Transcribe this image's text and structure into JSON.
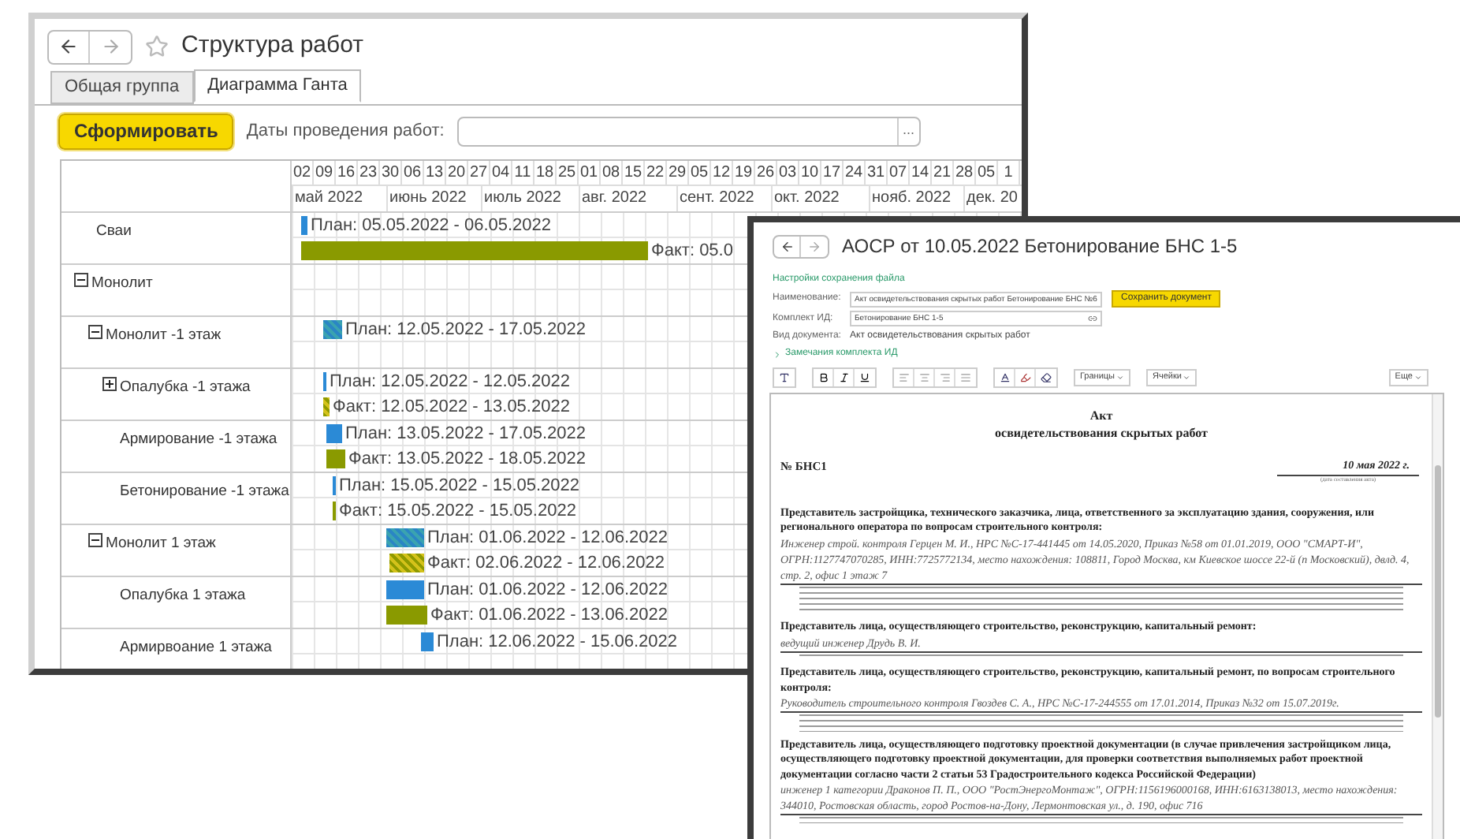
{
  "gantt_window": {
    "title": "Структура работ",
    "tabs": [
      {
        "label": "Общая группа",
        "selected": false
      },
      {
        "label": "Диаграмма Ганта",
        "selected": true
      }
    ],
    "generate_button": "Сформировать",
    "dates_label": "Даты проведения работ:",
    "dates_field_button": "...",
    "gantt": {
      "week_days": [
        "02",
        "09",
        "16",
        "23",
        "30",
        "06",
        "13",
        "20",
        "27",
        "04",
        "11",
        "18",
        "25",
        "01",
        "08",
        "15",
        "22",
        "29",
        "05",
        "12",
        "19",
        "26",
        "03",
        "10",
        "17",
        "24",
        "31",
        "07",
        "14",
        "21",
        "28",
        "05",
        "1"
      ],
      "months": [
        "май 2022",
        "июнь 2022",
        "июль 2022",
        "авг. 2022",
        "сент. 2022",
        "окт. 2022",
        "нояб. 2022",
        "дек. 20"
      ],
      "rows": [
        {
          "name": "Сваи",
          "bars": [
            {
              "kind": "plan",
              "hatched": false,
              "label": "План: 05.05.2022 - 06.05.2022"
            },
            {
              "kind": "fact",
              "hatched": false,
              "label": "Факт: 05.0"
            }
          ]
        },
        {
          "name": "Монолит",
          "expanded": true,
          "bars": [],
          "children": [
            {
              "name": "Монолит -1 этаж",
              "expanded": true,
              "bars": [
                {
                  "kind": "plan",
                  "hatched": true,
                  "label": "План: 12.05.2022 - 17.05.2022"
                }
              ],
              "children": [
                {
                  "name": "Опалубка -1 этажа",
                  "expanded": false,
                  "bars": [
                    {
                      "kind": "plan",
                      "hatched": false,
                      "label": "План: 12.05.2022 - 12.05.2022"
                    },
                    {
                      "kind": "fact",
                      "hatched": true,
                      "label": "Факт: 12.05.2022 - 13.05.2022"
                    }
                  ]
                },
                {
                  "name": "Армирование -1 этажа",
                  "bars": [
                    {
                      "kind": "plan",
                      "hatched": false,
                      "label": "План: 13.05.2022 - 17.05.2022"
                    },
                    {
                      "kind": "fact",
                      "hatched": false,
                      "label": "Факт: 13.05.2022 - 18.05.2022"
                    }
                  ]
                },
                {
                  "name": "Бетонирование -1 этажа",
                  "bars": [
                    {
                      "kind": "plan",
                      "hatched": false,
                      "label": "План: 15.05.2022 - 15.05.2022"
                    },
                    {
                      "kind": "fact",
                      "hatched": false,
                      "label": "Факт: 15.05.2022 - 15.05.2022"
                    }
                  ]
                }
              ]
            },
            {
              "name": "Монолит 1 этаж",
              "expanded": true,
              "bars": [
                {
                  "kind": "plan",
                  "hatched": true,
                  "label": "План: 01.06.2022 - 12.06.2022"
                },
                {
                  "kind": "fact",
                  "hatched": true,
                  "label": "Факт: 02.06.2022 - 12.06.2022"
                }
              ],
              "children": [
                {
                  "name": "Опалубка 1 этажа",
                  "bars": [
                    {
                      "kind": "plan",
                      "hatched": false,
                      "label": "План: 01.06.2022 - 12.06.2022"
                    },
                    {
                      "kind": "fact",
                      "hatched": false,
                      "label": "Факт: 01.06.2022 - 13.06.2022"
                    }
                  ]
                },
                {
                  "name": "Армирвоание 1 этажа",
                  "bars": [
                    {
                      "kind": "plan",
                      "hatched": false,
                      "label": "План: 12.06.2022 - 15.06.2022"
                    }
                  ]
                }
              ]
            }
          ]
        }
      ]
    }
  },
  "doc_window": {
    "title": "АОСР от 10.05.2022 Бетонирование БНС 1-5",
    "settings_link": "Настройки сохранения файла",
    "fields": [
      {
        "label": "Наименование:",
        "value": "Акт освидетельствования скрытых работ Бетонирование БНС №6"
      },
      {
        "label": "Комплект ИД:",
        "value": "Бетонирование БНС 1-5"
      }
    ],
    "save_button": "Сохранить документ",
    "doc_type_label": "Вид документа:",
    "doc_type_value": "Акт освидетельствования скрытых работ",
    "remarks_link": "Замечания комплекта ИД",
    "toolbar": {
      "borders_button": "Границы",
      "cells_button": "Ячейки",
      "more_button": "Еще"
    },
    "document": {
      "title_lines": [
        "Акт",
        "освидетельствования скрытых работ"
      ],
      "number": "№ БНС1",
      "date": "10 мая 2022 г.",
      "date_caption": "(дата составления акта)",
      "sections": [
        {
          "heading": "Представитель застройщика, технического заказчика, лица, ответственного за эксплуатацию  здания, сооружения, или регионального оператора по вопросам строительного контроля:",
          "value": "Инженер строй. контроля Герцен М. И., НРС №С-17-441445 от 14.05.2020, Приказ №58 от 01.01.2019, ООО \"СМАРТ-И\", ОГРН:1127747070285, ИНН:7725772134, место нахождения: 108811, Город Москва, км Киевское шоссе 22-й (п Московский), двлд. 4, стр. 2, офис 1 этаж 7"
        },
        {
          "heading": "Представитель лица, осуществляющего строительство, реконструкцию, капитальный ремонт:",
          "value": "ведущий инженер Друдь В. И."
        },
        {
          "heading": "Представитель лица, осуществляющего строительство, реконструкцию, капитальный ремонт, по вопросам строительного контроля:",
          "value": "Руководитель строительного контроля Гвоздев С. А., НРС №С-17-244555 от 17.01.2014, Приказ №32 от 15.07.2019г."
        },
        {
          "heading": "Представитель лица, осуществляющего подготовку проектной документации (в случае привлечения застройщиком лица, осуществляющего подготовку проектной документации, для проверки соответствия выполняемых работ проектной документации согласно части 2 статьи 53 Градостроительного кодекса Российской Федерации)",
          "value": "инженер 1 категории Драконов П. П., ООО \"РостЭнергоМонтаж\", ОГРН:1156196000168, ИНН:6163138013, место нахождения: 344010, Ростовская область, город Ростов-на-Дону, Лермонтовская ул., д. 190, офис 716"
        }
      ]
    }
  }
}
